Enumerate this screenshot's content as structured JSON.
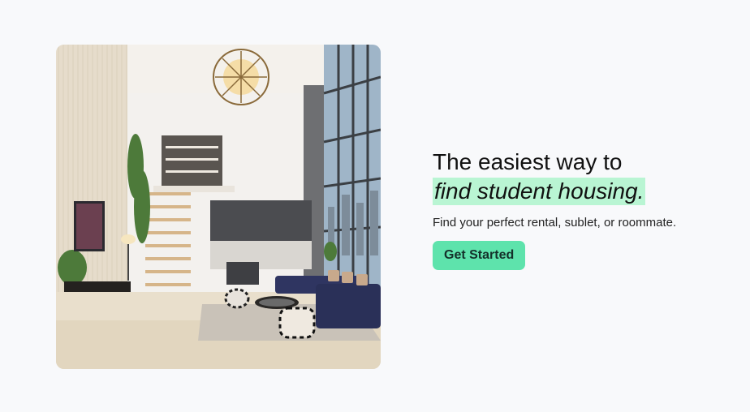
{
  "hero": {
    "headline_line1": "The easiest way to",
    "headline_line2": "find student housing.",
    "subtext": "Find your perfect rental, sublet, or roommate.",
    "cta_label": "Get Started"
  },
  "colors": {
    "background": "#f8f9fb",
    "highlight": "#b9f5d3",
    "cta": "#5ee3ac",
    "cta_text": "#14312a"
  },
  "image": {
    "subject": "loft-apartment-interior"
  }
}
